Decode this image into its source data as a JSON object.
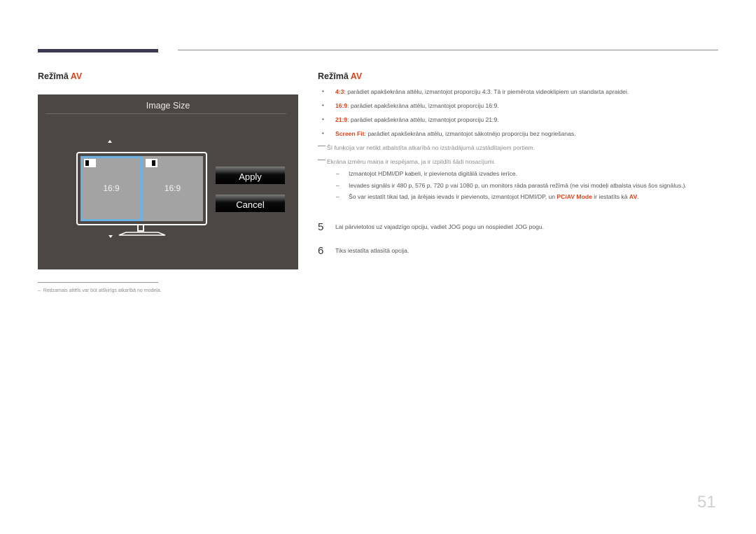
{
  "header": {
    "left_title_prefix": "Režīmā",
    "left_title_accent": "AV",
    "right_title_prefix": "Režīmā",
    "right_title_accent": "AV"
  },
  "osd": {
    "title": "Image Size",
    "panes": [
      {
        "label": "16:9",
        "selected": true
      },
      {
        "label": "16:9",
        "selected": false
      }
    ],
    "apply_label": "Apply",
    "cancel_label": "Cancel",
    "colors": {
      "background": "#4c4745",
      "selection": "#6cb1e2",
      "screen": "#a3a3a3"
    }
  },
  "options": [
    {
      "key": "4:3",
      "text": ": parādiet apakšekrāna attēlu, izmantojot proporciju 4:3. Tā ir piemērota videoklipiem un standarta apraidei."
    },
    {
      "key": "16:9",
      "text": ": parādiet apakšekrāna attēlu, izmantojot proporciju 16:9."
    },
    {
      "key": "21:9",
      "text": ": parādiet apakšekrāna attēlu, izmantojot proporciju 21:9."
    },
    {
      "key": "Screen Fit",
      "text": ": parādiet apakšekrāna attēlu, izmantojot sākotnējo proporciju bez nogriešanas."
    }
  ],
  "notes": [
    "Šī funkcija var netikt atbalstīta atkarībā no izstrādājumā uzstādītajiem portiem.",
    "Ekrāna izmēru maiņa ir iespējama, ja ir izpildīti šādi nosacījumi."
  ],
  "conditions": [
    {
      "text": "Izmantojot HDMI/DP kabeli, ir pievienota digitālā izvades ierīce."
    },
    {
      "text": "Ievades signāls ir 480 p, 576 p, 720 p vai 1080 p, un monitors rāda parastā režīmā (ne visi modeļi atbalsta visus šos signālus.)."
    },
    {
      "pre": "Šo var iestatīt tikai tad, ja ārējais ievads ir pievienots, izmantojot HDMI/DP, un ",
      "kw1": "PC/AV Mode",
      "mid": " ir iestatīts kā ",
      "kw2": "AV",
      "post": "."
    }
  ],
  "steps": [
    {
      "num": "5",
      "text": "Lai pārvietotos uz vajadzīgo opciju, vadiet JOG pogu un nospiediet JOG pogu."
    },
    {
      "num": "6",
      "text": "Tiks iestatīta atlasītā opcija."
    }
  ],
  "footnote": "Redzamais attēls var būt atšķirīgs atkarībā no modeļa.",
  "page_number": "51",
  "accent_color": "#d3461e"
}
